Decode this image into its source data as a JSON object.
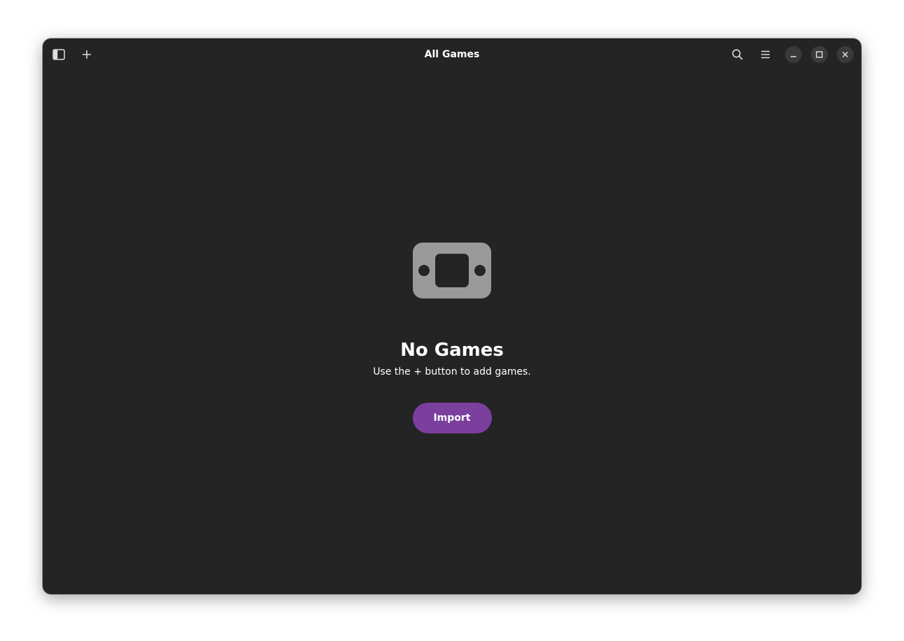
{
  "window": {
    "title": "All Games"
  },
  "toolbar": {
    "sidebar_toggle_icon": "sidebar-show-icon",
    "add_icon": "plus-icon",
    "search_icon": "search-icon",
    "menu_icon": "hamburger-menu-icon",
    "minimize_icon": "minimize-icon",
    "maximize_icon": "maximize-icon",
    "close_icon": "close-icon"
  },
  "empty_state": {
    "icon": "gamepad-icon",
    "title": "No Games",
    "description": "Use the + button to add games.",
    "action_label": "Import"
  },
  "colors": {
    "window_bg": "#242424",
    "accent": "#7b3f9e",
    "icon_gray": "#9a9a9a"
  }
}
